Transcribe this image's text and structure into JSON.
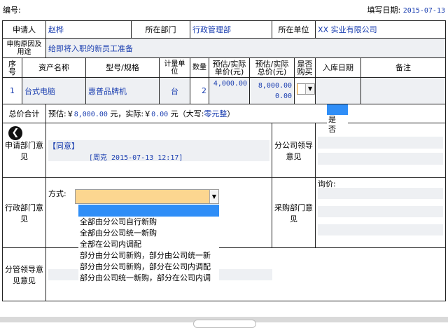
{
  "header": {
    "number_label": "编号:",
    "fill_date_label": "填写日期:",
    "fill_date": "2015-07-13"
  },
  "applicant": {
    "applicant_label": "申请人",
    "applicant_value": "赵桦",
    "dept_label": "所在部门",
    "dept_value": "行政管理部",
    "unit_label": "所在单位",
    "unit_value": "XX 实业有限公司"
  },
  "reason": {
    "label": "申购原因及用途",
    "value": "给即将入职的新员工准备"
  },
  "items_table": {
    "headers": [
      "序号",
      "资产名称",
      "型号/规格",
      "计量单位",
      "数量",
      "预估/实际单价(元)",
      "预估/实际总价(元)",
      "是否购买",
      "入库日期",
      "备注"
    ],
    "rows": [
      {
        "index": "1",
        "name": "台式电脑",
        "model": "惠普品牌机",
        "unit": "台",
        "qty": "2",
        "unit_price": "4,000.00",
        "total_est": "8,000.00",
        "total_actual": "0.00"
      }
    ]
  },
  "total": {
    "label": "总价合计",
    "est_prefix": "预估:￥",
    "est_value": "8,000.00",
    "actual_prefix": "元，实际:￥",
    "actual_value": "0.00",
    "caps_prefix": "元（大写:",
    "caps_value": "零元整",
    "caps_suffix": "）"
  },
  "yesno_dropdown": {
    "options": [
      "是",
      "否"
    ]
  },
  "dept_opinion": {
    "label": "申请部门意见",
    "tag": "【同意】",
    "signer": "[周克 2015-07-13 12:17]"
  },
  "branch_leader": {
    "label": "分公司领导意见"
  },
  "admin_dept": {
    "label": "行政部门意见",
    "method_label": "方式:",
    "method_options": [
      "全部由分公司自行新购",
      "全部由分公司统一新购",
      "全部在公司内调配",
      "部分由分公司新购，部分由公司统一新",
      "部分由分公司新购，部分在公司内调配",
      "部分由公司统一新购，部分在公司内调"
    ]
  },
  "purchase_dept": {
    "label": "采购部门意见",
    "inquiry_label": "询价:"
  },
  "leader": {
    "label": "分管领导意见意见"
  },
  "colors": {
    "link_blue": "#1a3eb0",
    "highlight_blue": "#2f8ef7",
    "select_yellow": "#fcd690",
    "field_grey": "#eef0f3"
  }
}
